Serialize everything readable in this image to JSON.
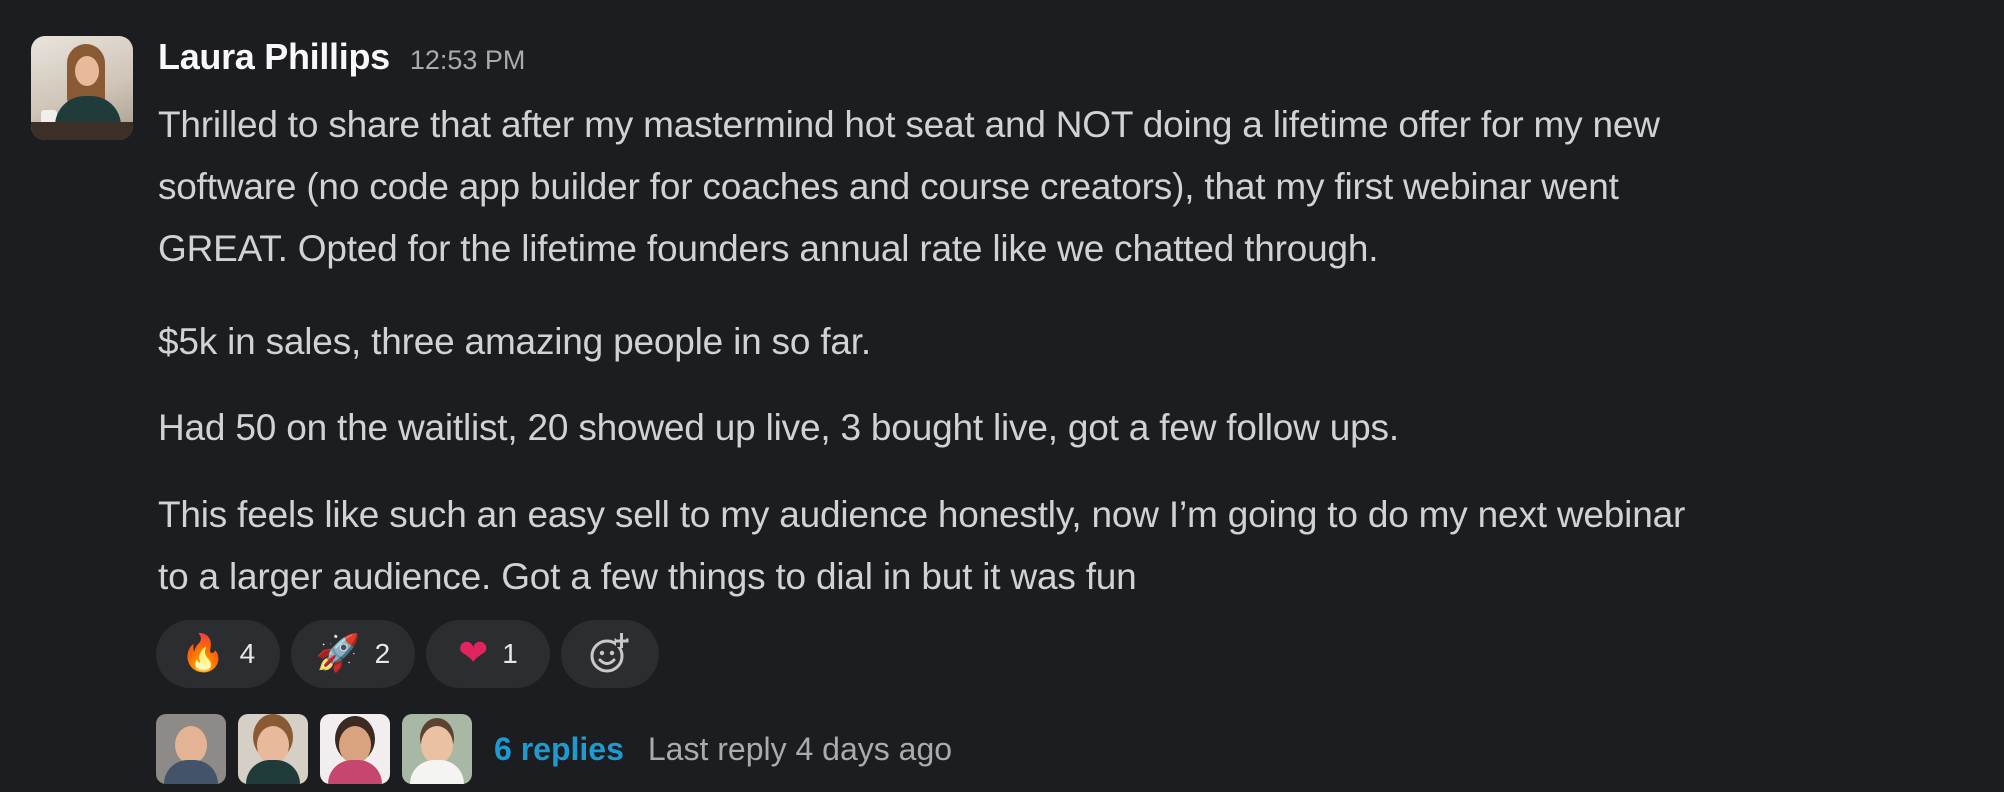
{
  "message": {
    "author": "Laura Phillips",
    "timestamp": "12:53 PM",
    "paragraphs": [
      "Thrilled to share that after my mastermind hot seat and NOT doing a lifetime offer for my new\nsoftware (no code app builder for coaches and course creators), that my first webinar went\nGREAT. Opted for the lifetime founders annual rate like we chatted through.",
      "$5k in sales, three amazing people in so far.",
      "Had 50 on the waitlist, 20 showed up live, 3 bought live, got a few follow ups.",
      "This feels like such an easy sell to my audience honestly, now I’m going to do my next webinar\nto a larger audience. Got a few things to dial in but it was fun"
    ]
  },
  "reactions": [
    {
      "emoji": "🔥",
      "icon": "fire-emoji",
      "count": "4"
    },
    {
      "emoji": "🚀",
      "icon": "rocket-emoji",
      "count": "2"
    },
    {
      "emoji": "❤",
      "icon": "red-heart-emoji",
      "count": "1"
    }
  ],
  "add_reaction_icon": "add-reaction-icon",
  "thread": {
    "participant_count_shown": 4,
    "replies_label": "6 replies",
    "last_reply": "Last reply 4 days ago"
  },
  "colors": {
    "background": "#1b1d21",
    "text": "#d1d2d3",
    "author": "#f8f8f8",
    "muted": "#ababad",
    "link": "#1d9bd1",
    "reaction_pill": "#2c2d31"
  }
}
